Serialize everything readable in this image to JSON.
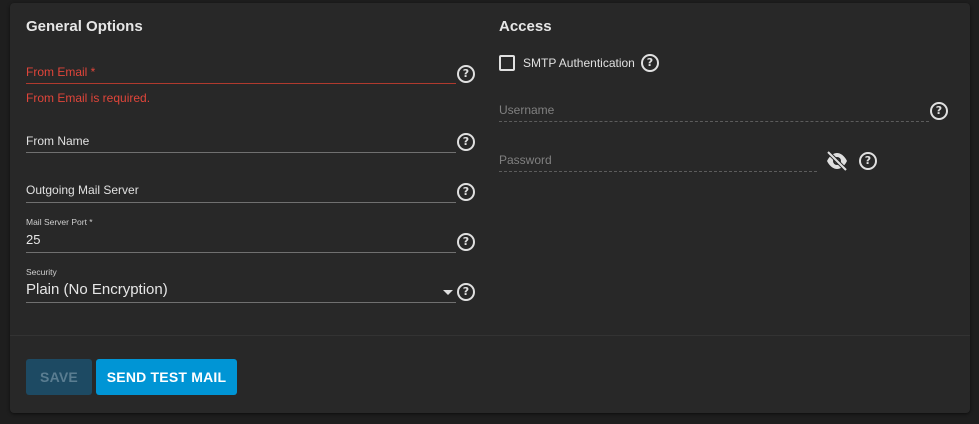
{
  "general": {
    "title": "General Options",
    "from_email": {
      "label": "From Email *",
      "error": "From Email is required.",
      "help": "?"
    },
    "from_name": {
      "label": "From Name",
      "help": "?"
    },
    "outgoing_server": {
      "label": "Outgoing Mail Server",
      "help": "?"
    },
    "port": {
      "label": "Mail Server Port *",
      "value": "25",
      "help": "?"
    },
    "security": {
      "label": "Security",
      "value": "Plain (No Encryption)",
      "help": "?"
    }
  },
  "access": {
    "title": "Access",
    "smtp_auth": {
      "label": "SMTP Authentication",
      "checked": false,
      "help": "?"
    },
    "username": {
      "placeholder": "Username",
      "help": "?"
    },
    "password": {
      "placeholder": "Password",
      "help": "?",
      "toggle_icon": "visibility-off-icon"
    }
  },
  "actions": {
    "save_label": "SAVE",
    "send_test_label": "SEND TEST MAIL"
  },
  "colors": {
    "accent": "#0095d5",
    "error": "#e0453a",
    "card": "#282828",
    "background": "#1e1e1e"
  }
}
